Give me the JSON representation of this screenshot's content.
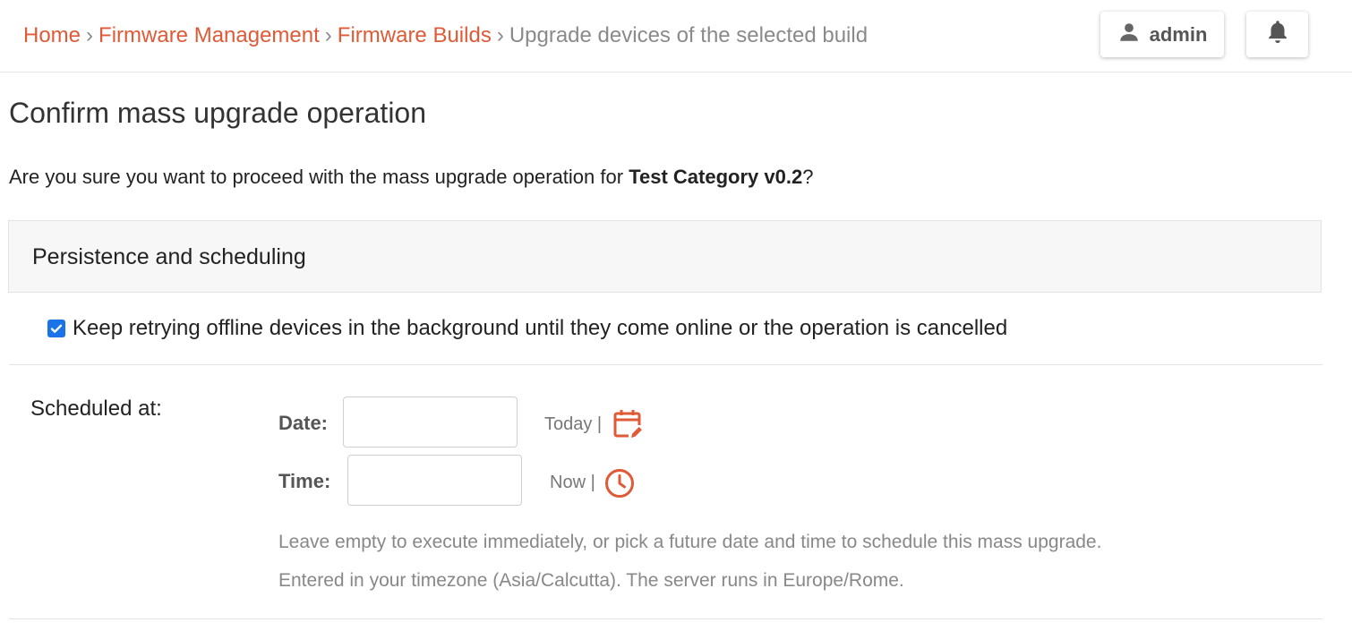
{
  "breadcrumb": {
    "items": [
      {
        "label": "Home"
      },
      {
        "label": "Firmware Management"
      },
      {
        "label": "Firmware Builds"
      }
    ],
    "separator": "›",
    "current": "Upgrade devices of the selected build"
  },
  "header": {
    "user_label": "admin",
    "icons": {
      "user": "person-icon",
      "notifications": "bell-icon"
    }
  },
  "page": {
    "title": "Confirm mass upgrade operation",
    "confirm_prefix": "Are you sure you want to proceed with the mass upgrade operation for ",
    "build_name": "Test Category v0.2",
    "confirm_suffix": "?"
  },
  "panel": {
    "title": "Persistence and scheduling",
    "retry_checked": true,
    "retry_label": "Keep retrying offline devices in the background until they come online or the operation is cancelled"
  },
  "schedule": {
    "label": "Scheduled at:",
    "date_label": "Date:",
    "date_value": "",
    "date_shortcut": "Today |",
    "time_label": "Time:",
    "time_value": "",
    "time_shortcut": "Now |",
    "help_line1": "Leave empty to execute immediately, or pick a future date and time to schedule this mass upgrade.",
    "help_line2": "Entered in your timezone (Asia/Calcutta). The server runs in Europe/Rome."
  },
  "colors": {
    "accent": "#df5a36",
    "checkbox": "#1a73e8",
    "muted": "#8a8a8a"
  }
}
